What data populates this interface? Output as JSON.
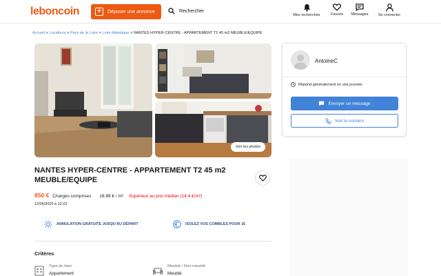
{
  "header": {
    "logo": "leboncoin",
    "post_label": "Déposer une annonce",
    "search_label": "Rechercher",
    "nav": [
      {
        "label": "Mes recherches",
        "icon": "bell-icon"
      },
      {
        "label": "Favoris",
        "icon": "heart-icon"
      },
      {
        "label": "Messages",
        "icon": "message-icon"
      },
      {
        "label": "Se connecter",
        "icon": "user-icon"
      }
    ]
  },
  "breadcrumb": {
    "items": [
      "Accueil",
      "Locations",
      "Pays de la Loire",
      "Loire-Atlantique"
    ],
    "separator": ">",
    "current": "NANTES HYPER-CENTRE - APPARTEMENT T2 45 m2 MEUBLE/EQUIPE"
  },
  "gallery": {
    "view_photos_label": "Voir les photos"
  },
  "listing": {
    "title": "NANTES HYPER-CENTRE - APPARTEMENT T2 45 m2 MEUBLE/EQUIPE",
    "price": "850 €",
    "charges": "Charges comprises",
    "price_per_m2": "18.89 € / m²",
    "median_note": "Supérieur au prix médian (14.4 €/m²)",
    "date": "12/06/2020 à 12:22"
  },
  "promos": [
    {
      "label": "ANNULATION GRATUITE JUSQU'AU DÉPART",
      "icon": "sun-icon"
    },
    {
      "label": "ISOLEZ VOS COMBLES POUR 1€",
      "icon": "euro-icon"
    }
  ],
  "criteria": {
    "heading": "Critères",
    "items": [
      {
        "key": "Type de bien",
        "value": "Appartement",
        "icon": "building-icon"
      },
      {
        "key": "Meublé / Non meublé",
        "value": "Meublé",
        "icon": "sofa-icon"
      }
    ]
  },
  "seller": {
    "name": "AntoineC",
    "respond_note": "Répond généralement en une journée",
    "message_label": "Envoyer un message",
    "phone_label": "Voir le numéro"
  },
  "colors": {
    "brand_orange": "#ec5a13",
    "accent_blue": "#4183d7",
    "alert_red": "#e6000f",
    "promo_blue": "#2c4a8a"
  }
}
